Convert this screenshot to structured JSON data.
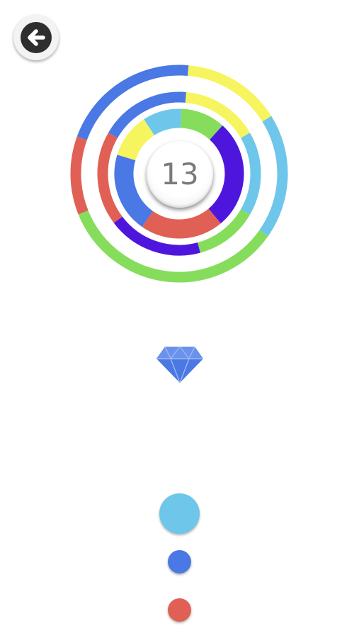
{
  "game": {
    "score": "13",
    "colors": {
      "red": "#e06055",
      "blue": "#4a78e4",
      "yellow": "#f6f560",
      "light_blue": "#6ec6ea",
      "green": "#86dd5c",
      "purple": "#4e16dc",
      "gem": "#4a78e4"
    },
    "rings": [
      {
        "name": "outer",
        "segments": [
          "blue",
          "yellow",
          "light_blue",
          "green",
          "red"
        ]
      },
      {
        "name": "middle",
        "segments": [
          "blue",
          "yellow",
          "light_blue",
          "green",
          "purple",
          "red"
        ]
      },
      {
        "name": "inner",
        "segments": [
          "light_blue",
          "green",
          "purple",
          "red",
          "blue",
          "yellow"
        ]
      }
    ],
    "pickup": "gem-icon",
    "queued_balls": [
      "light_blue",
      "blue",
      "red"
    ]
  },
  "back_button": {
    "icon": "arrow-left-icon"
  }
}
